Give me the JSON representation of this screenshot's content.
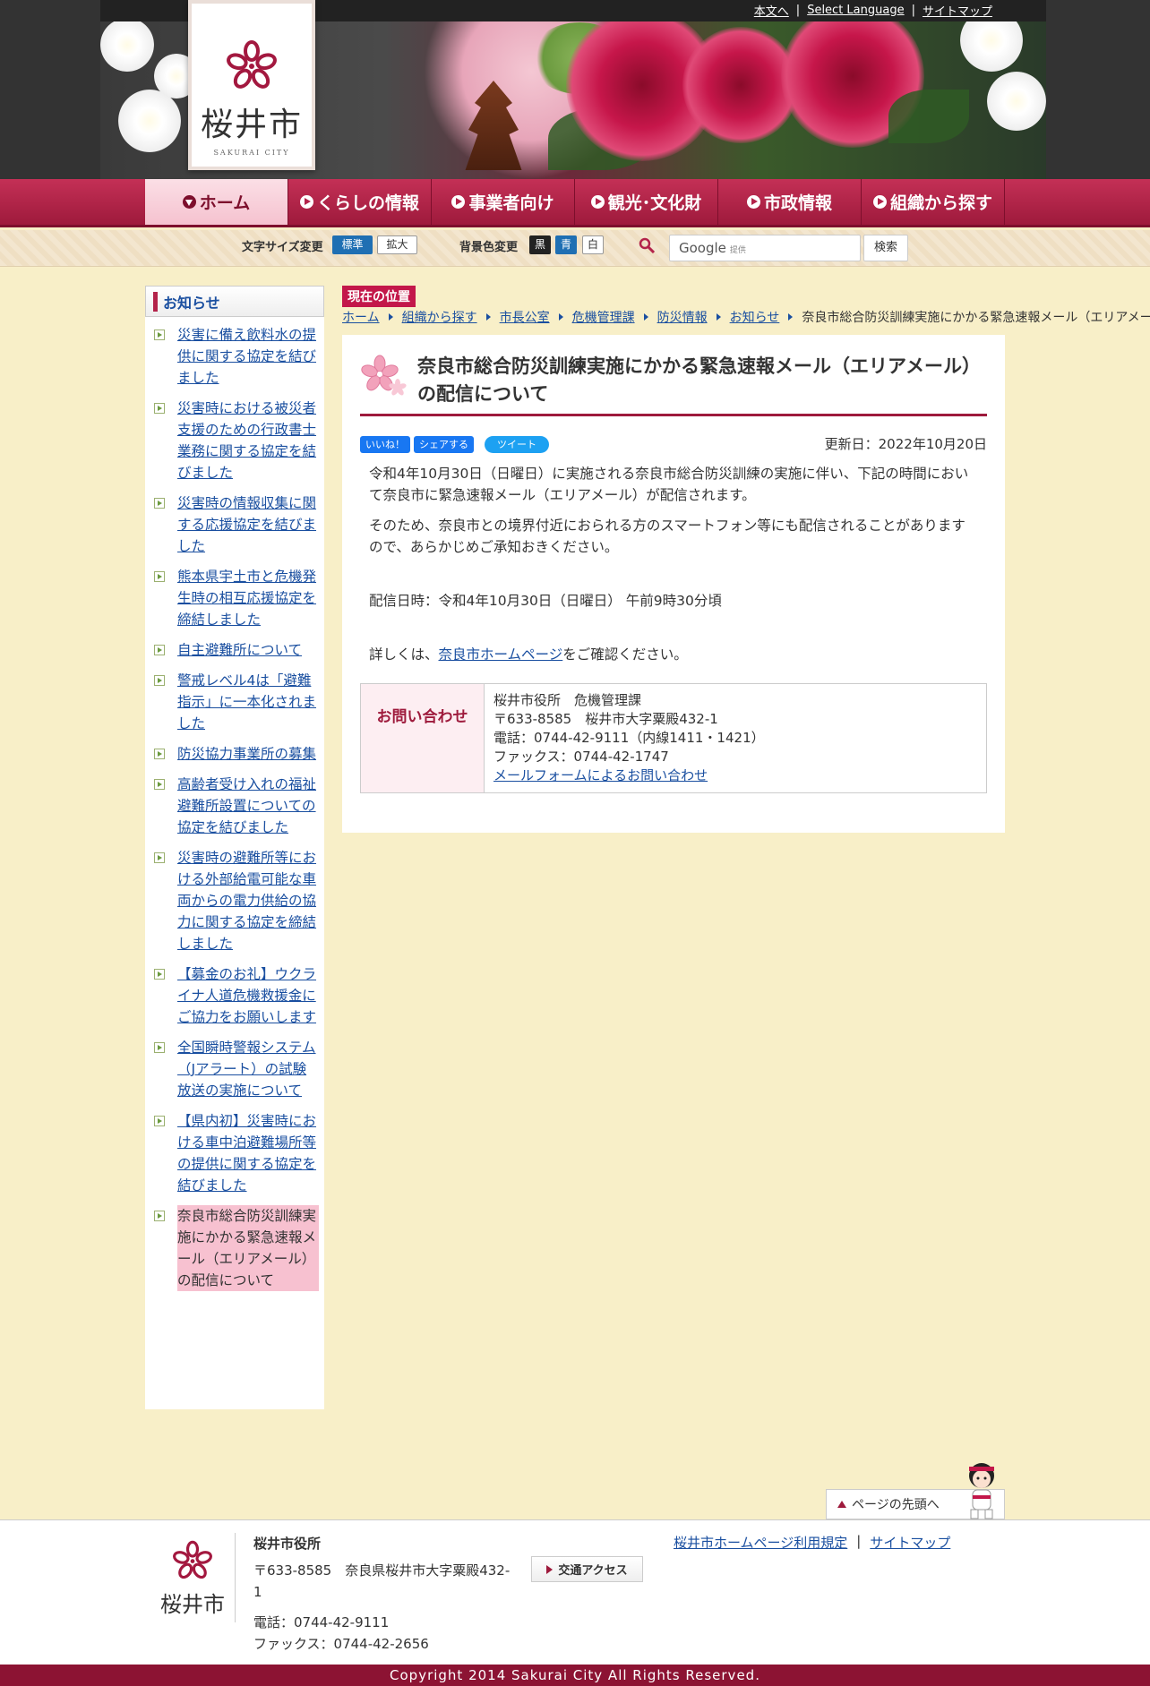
{
  "header": {
    "util_links": [
      "本文へ",
      "Select Language",
      "サイトマップ"
    ],
    "logo": {
      "name": "桜井市",
      "sub": "SAKURAI CITY"
    }
  },
  "nav": {
    "items": [
      "ホーム",
      "くらしの情報",
      "事業者向け",
      "観光･文化財",
      "市政情報",
      "組織から探す"
    ]
  },
  "tools": {
    "font_size_label": "文字サイズ変更",
    "font_standard": "標準",
    "font_large": "拡大",
    "bg_label": "背景色変更",
    "bg_black": "黒",
    "bg_blue": "青",
    "bg_white": "白",
    "search_brand": "Google",
    "search_powered": "提供",
    "search_button": "検索"
  },
  "sidebar": {
    "title": "お知らせ",
    "items": [
      "災害に備え飲料水の提供に関する協定を結びました",
      "災害時における被災者支援のための行政書士業務に関する協定を結びました",
      "災害時の情報収集に関する応援協定を結びました",
      "熊本県宇土市と危機発生時の相互応援協定を締結しました",
      "自主避難所について",
      "警戒レベル4は「避難指示」に一本化されました",
      "防災協力事業所の募集",
      "高齢者受け入れの福祉避難所設置についての協定を結びました",
      "災害時の避難所等における外部給電可能な車両からの電力供給の協力に関する協定を締結しました",
      "【募金のお礼】ウクライナ人道危機救援金にご協力をお願いします",
      "全国瞬時警報システム（Jアラート）の試験放送の実施について",
      "【県内初】災害時における車中泊避難場所等の提供に関する協定を結びました"
    ],
    "current": "奈良市総合防災訓練実施にかかる緊急速報メール（エリアメール）の配信について"
  },
  "breadcrumb": {
    "label": "現在の位置",
    "links": [
      "ホーム",
      "組織から探す",
      "市長公室",
      "危機管理課",
      "防災情報",
      "お知らせ"
    ],
    "current": "奈良市総合防災訓練実施にかかる緊急速報メール（エリアメール）の配信について"
  },
  "main": {
    "title": "奈良市総合防災訓練実施にかかる緊急速報メール（エリアメール）の配信について",
    "social": {
      "like": "いいね！",
      "share": "シェアする",
      "tweet": "ツイート"
    },
    "updated": "更新日：2022年10月20日",
    "para1": "令和4年10月30日（日曜日）に実施される奈良市総合防災訓練の実施に伴い、下記の時間において奈良市に緊急速報メール（エリアメール）が配信されます。",
    "para2": "そのため、奈良市との境界付近におられる方のスマートフォン等にも配信されることがありますので、あらかじめご承知おきください。",
    "para3": "配信日時：令和4年10月30日（日曜日） 午前9時30分頃",
    "para4_pre": "詳しくは、",
    "para4_link": "奈良市ホームページ",
    "para4_post": "をご確認ください。",
    "contact": {
      "label": "お問い合わせ",
      "dept": "桜井市役所　危機管理課",
      "address": "〒633-8585　桜井市大字粟殿432-1",
      "phone": "電話：0744-42-9111（内線1411・1421）",
      "fax": "ファックス：0744-42-1747",
      "mail_link": "メールフォームによるお問い合わせ"
    }
  },
  "pagetop": "ページの先頭へ",
  "footer": {
    "logo_name": "桜井市",
    "org": "桜井市役所",
    "address": "〒633-8585　奈良県桜井市大字粟殿432-1",
    "phone": "電話：0744-42-9111",
    "fax": "ファックス：0744-42-2656",
    "access": "交通アクセス",
    "links": [
      "桜井市ホームページ利用規定",
      "サイトマップ"
    ],
    "copyright": "Copyright 2014 Sakurai City All Rights Reserved."
  },
  "colors": {
    "primary": "#b3234a",
    "dark": "#8c1333",
    "link": "#1a4fa0",
    "background": "#f8efc8"
  }
}
